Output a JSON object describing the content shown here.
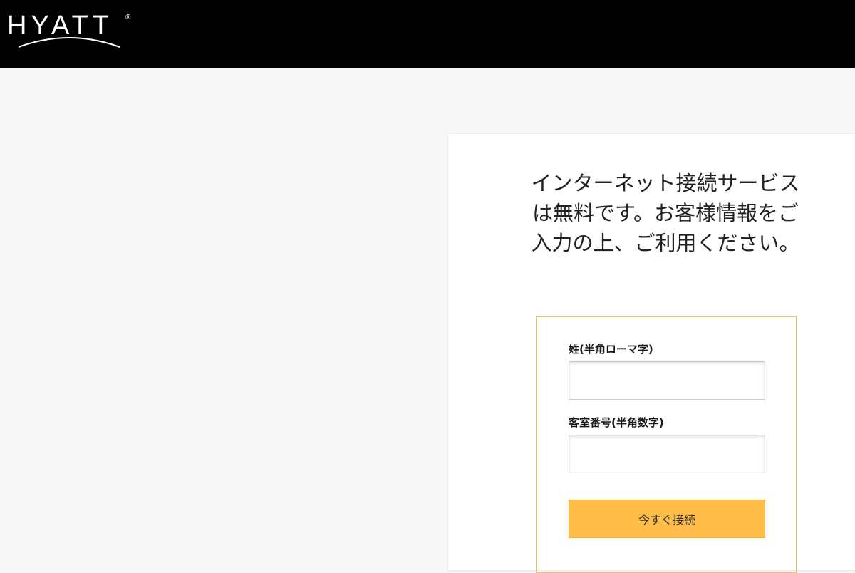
{
  "header": {
    "logo_text": "HYATT",
    "logo_mark": "®",
    "background": "#000000"
  },
  "card": {
    "headline": "インターネット接続サービスは無料です。お客様情報をご入力の上、ご利用ください。"
  },
  "form": {
    "surname_label": "姓(半角ローマ字)",
    "surname_value": "",
    "room_label": "客室番号(半角数字)",
    "room_value": "",
    "connect_label": "今すぐ接続",
    "border_color": "#f0c040",
    "button_color": "#ffbe4a"
  }
}
